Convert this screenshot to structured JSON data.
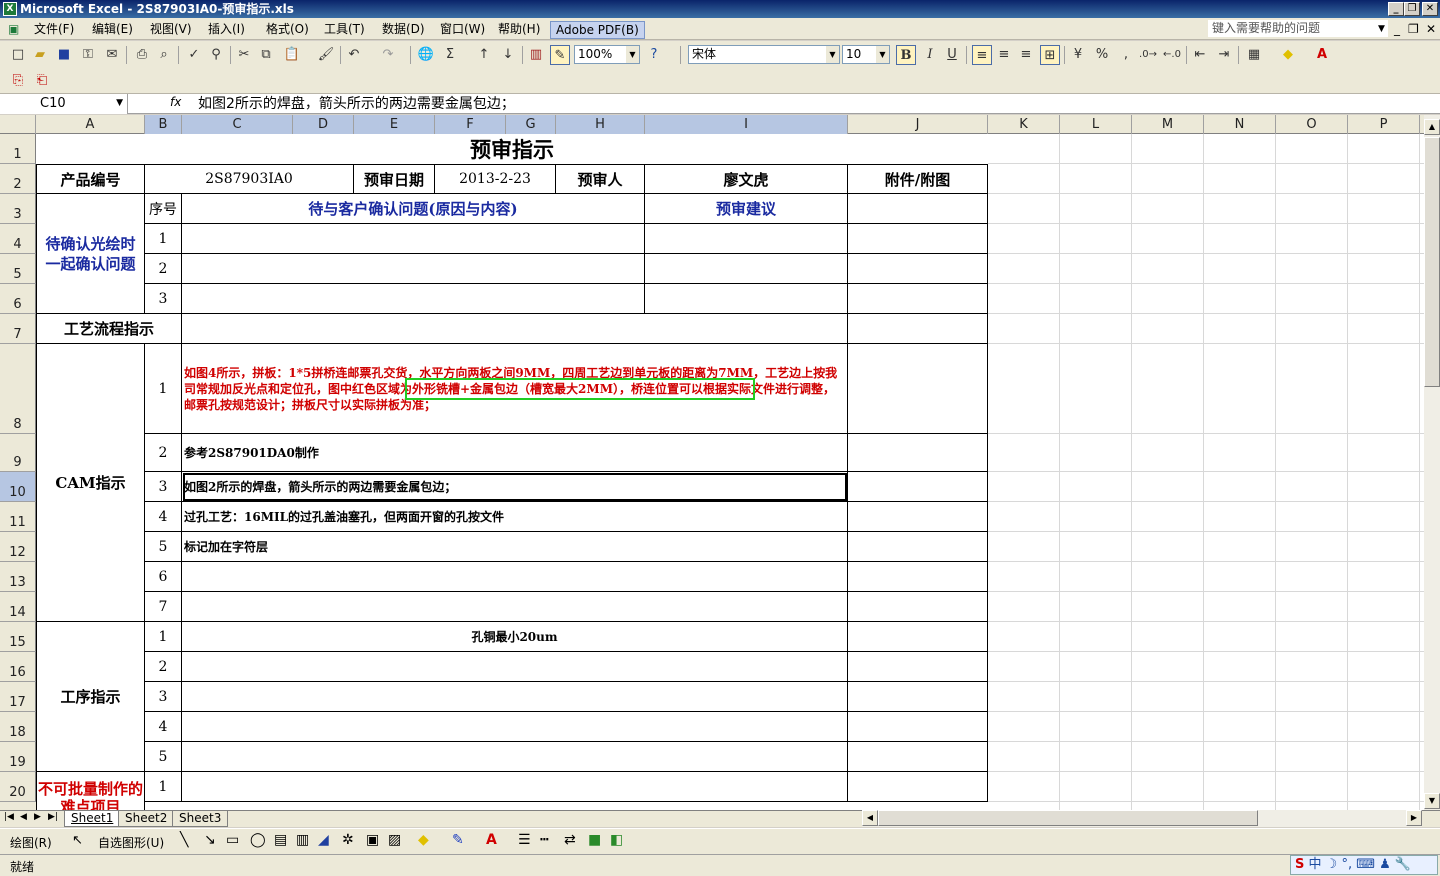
{
  "window": {
    "title": "Microsoft Excel - 2S87903IA0-预审指示.xls",
    "icon": "excel-icon"
  },
  "menu": [
    "文件(F)",
    "编辑(E)",
    "视图(V)",
    "插入(I)",
    "格式(O)",
    "工具(T)",
    "数据(D)",
    "窗口(W)",
    "帮助(H)",
    "Adobe PDF(B)"
  ],
  "help_placeholder": "键入需要帮助的问题",
  "toolbar": {
    "zoom": "100%",
    "font": "宋体",
    "font_size": "10",
    "bold": "B",
    "italic": "I",
    "underline": "U",
    "percent": "%",
    "comma": ","
  },
  "formula_bar": {
    "name_box": "C10",
    "fx": "fx",
    "formula": "如图2所示的焊盘，箭头所示的两边需要金属包边；"
  },
  "columns": [
    "A",
    "B",
    "C",
    "D",
    "E",
    "F",
    "G",
    "H",
    "I",
    "J",
    "K",
    "L",
    "M",
    "N",
    "O",
    "P"
  ],
  "rows": [
    "1",
    "2",
    "3",
    "4",
    "5",
    "6",
    "7",
    "8",
    "9",
    "10",
    "11",
    "12",
    "13",
    "14",
    "15",
    "16",
    "17",
    "18",
    "19",
    "20"
  ],
  "sheet": {
    "title": "预审指示",
    "product_label": "产品编号",
    "product_value": "2S87903IA0",
    "date_label": "预审日期",
    "date_value": "2013-2-23",
    "reviewer_label": "预审人",
    "reviewer_value": "廖文虎",
    "attach_label": "附件/附图",
    "confirm_section": "待确认光绘时一起确认问题",
    "seq_label": "序号",
    "issues_label": "待与客户确认问题(原因与内容)",
    "advice_label": "预审建议",
    "process_label": "工艺流程指示",
    "cam_label": "CAM指示",
    "cam_text_1": "如图4所示，拼板：1*5拼桥连邮票孔交货，水平方向两板之间9MM，四周工艺边到单元板的距离为7MM，工艺边上按我司常规加反光点和定位孔，图中红色区域为外形铣槽+金属包边（槽宽最大2MM），桥连位置可以根据实际文件进行调整，邮票孔按规范设计；拼板尺寸以实际拼板为准；",
    "cam_text_2": "参考2S87901DA0制作",
    "cam_text_3": "如图2所示的焊盘，箭头所示的两边需要金属包边；",
    "cam_text_4": "过孔工艺：16MIL的过孔盖油塞孔，但两面开窗的孔按文件",
    "cam_text_5": "标记加在字符层",
    "proc_label": "工序指示",
    "proc_text_1": "孔铜最小20um",
    "batch_label": "不可批量制作的难点项目",
    "n1": "1",
    "n2": "2",
    "n3": "3",
    "n4": "4",
    "n5": "5",
    "n6": "6",
    "n7": "7"
  },
  "sheet_tabs": [
    "Sheet1",
    "Sheet2",
    "Sheet3"
  ],
  "drawing": {
    "draw": "绘图(R)",
    "autoshape": "自选图形(U)"
  },
  "status": "就绪",
  "ime": "中"
}
